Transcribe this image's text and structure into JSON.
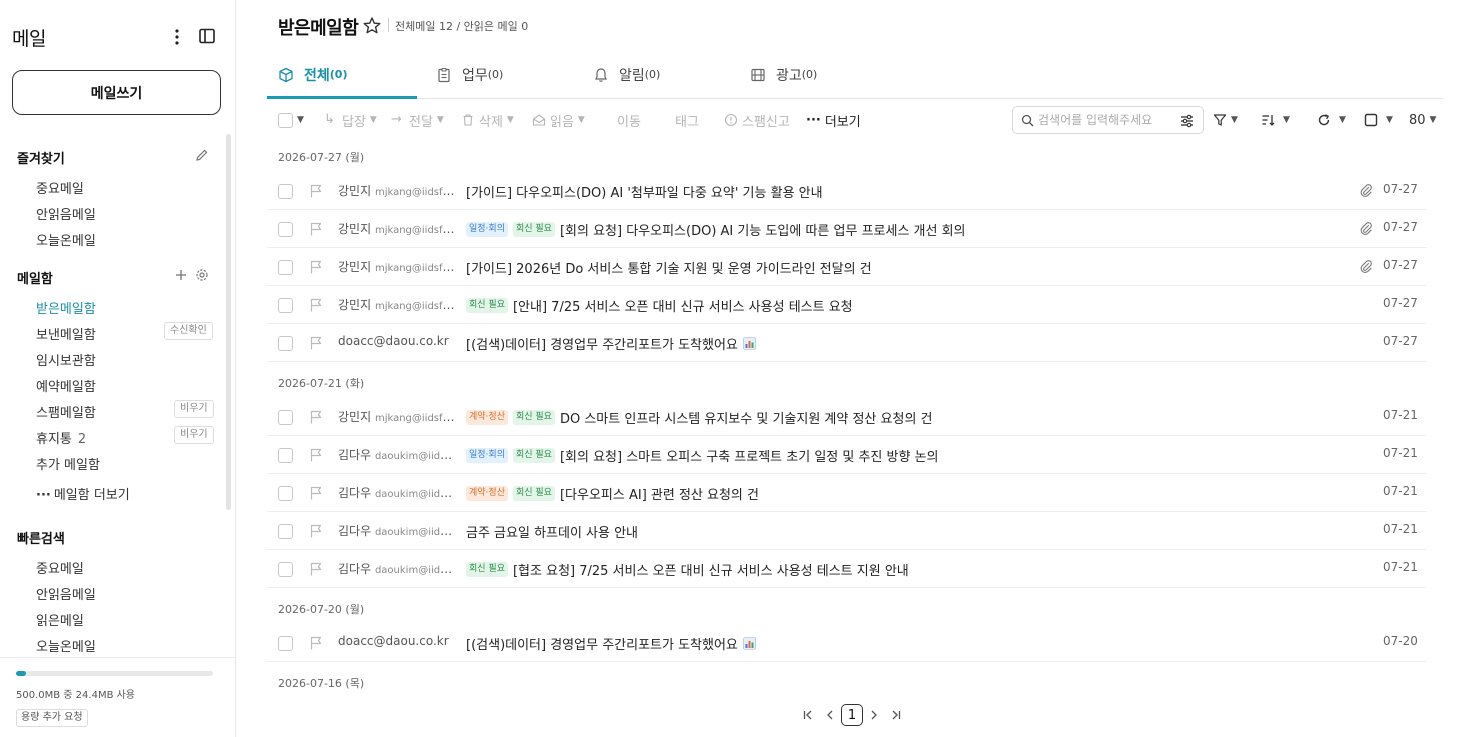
{
  "sidebar": {
    "title": "메일",
    "compose_label": "메일쓰기",
    "favorites": {
      "title": "즐겨찾기",
      "items": [
        "중요메일",
        "안읽음메일",
        "오늘온메일"
      ]
    },
    "mailboxes": {
      "title": "메일함",
      "inbox": "받은메일함",
      "sent": "보낸메일함",
      "sent_badge": "수신확인",
      "drafts": "임시보관함",
      "scheduled": "예약메일함",
      "spam": "스팸메일함",
      "spam_badge": "비우기",
      "trash": "휴지통",
      "trash_count": "2",
      "trash_badge": "비우기",
      "add": "추가 메일함",
      "more": "메일함 더보기"
    },
    "quick_search": {
      "title": "빠른검색",
      "items": [
        "중요메일",
        "안읽음메일",
        "읽은메일",
        "오늘온메일"
      ]
    },
    "quota": {
      "used_fraction": 0.049,
      "text": "500.0MB 중 24.4MB 사용",
      "add_label": "용량 추가 요청"
    }
  },
  "header": {
    "title": "받은메일함",
    "stats": "전체메일 12 / 안읽은 메일 0"
  },
  "tabs": [
    {
      "label": "전체",
      "count": "(0)",
      "icon": "cube-icon"
    },
    {
      "label": "업무",
      "count": "(0)",
      "icon": "clipboard-icon"
    },
    {
      "label": "알림",
      "count": "(0)",
      "icon": "bell-icon"
    },
    {
      "label": "광고",
      "count": "(0)",
      "icon": "film-icon"
    }
  ],
  "toolbar": {
    "reply": "답장",
    "forward": "전달",
    "delete": "삭제",
    "read": "읽음",
    "move": "이동",
    "tag": "태그",
    "spam": "스팸신고",
    "more": "더보기",
    "search_placeholder": "검색어를 입력해주세요",
    "page_size": "80"
  },
  "groups": [
    {
      "date": "2026-07-27 (월)",
      "mails": [
        {
          "name": "강민지",
          "email": "mjkang@iidsfn1...",
          "tags": [],
          "subject": "[가이드] 다우오피스(DO) AI '첨부파일 다중 요약' 기능 활용 안내",
          "attach": true,
          "chart": false,
          "date": "07-27"
        },
        {
          "name": "강민지",
          "email": "mjkang@iidsfn1...",
          "tags": [
            {
              "t": "일정·회의",
              "k": "meet"
            },
            {
              "t": "회신 필요",
              "k": "reply"
            }
          ],
          "subject": "[회의 요청] 다우오피스(DO) AI 기능 도입에 따른 업무 프로세스 개선 회의",
          "attach": true,
          "chart": false,
          "date": "07-27"
        },
        {
          "name": "강민지",
          "email": "mjkang@iidsfn1...",
          "tags": [],
          "subject": "[가이드] 2026년 Do 서비스 통합 기술 지원 및 운영 가이드라인 전달의 건",
          "attach": true,
          "chart": false,
          "date": "07-27"
        },
        {
          "name": "강민지",
          "email": "mjkang@iidsfn1...",
          "tags": [
            {
              "t": "회신 필요",
              "k": "reply"
            }
          ],
          "subject": "[안내] 7/25 서비스 오픈 대비 신규 서비스 사용성 테스트 요청",
          "attach": false,
          "chart": false,
          "date": "07-27"
        },
        {
          "name": "",
          "email": "doacc@daou.co.kr",
          "tags": [],
          "subject": "[(검색)데이터] 경영업무 주간리포트가 도착했어요",
          "attach": false,
          "chart": true,
          "date": "07-27"
        }
      ]
    },
    {
      "date": "2026-07-21 (화)",
      "mails": [
        {
          "name": "강민지",
          "email": "mjkang@iidsfn1...",
          "tags": [
            {
              "t": "계약·정산",
              "k": "bill"
            },
            {
              "t": "회신 필요",
              "k": "reply"
            }
          ],
          "subject": "DO 스마트 인프라 시스템 유지보수 및 기술지원 계약 정산 요청의 건",
          "attach": false,
          "chart": false,
          "date": "07-21"
        },
        {
          "name": "김다우",
          "email": "daoukim@iidsf...",
          "tags": [
            {
              "t": "일정·회의",
              "k": "meet"
            },
            {
              "t": "회신 필요",
              "k": "reply"
            }
          ],
          "subject": "[회의 요청] 스마트 오피스 구축 프로젝트 초기 일정 및 추진 방향 논의",
          "attach": false,
          "chart": false,
          "date": "07-21"
        },
        {
          "name": "김다우",
          "email": "daoukim@iidsf...",
          "tags": [
            {
              "t": "계약·정산",
              "k": "bill"
            },
            {
              "t": "회신 필요",
              "k": "reply"
            }
          ],
          "subject": "[다우오피스 AI] 관련 정산 요청의 건",
          "attach": false,
          "chart": false,
          "date": "07-21"
        },
        {
          "name": "김다우",
          "email": "daoukim@iidsf...",
          "tags": [],
          "subject": "금주 금요일 하프데이 사용 안내",
          "attach": false,
          "chart": false,
          "date": "07-21"
        },
        {
          "name": "김다우",
          "email": "daoukim@iidsf...",
          "tags": [
            {
              "t": "회신 필요",
              "k": "reply"
            }
          ],
          "subject": "[협조 요청] 7/25 서비스 오픈 대비 신규 서비스 사용성 테스트 지원 안내",
          "attach": false,
          "chart": false,
          "date": "07-21"
        }
      ]
    },
    {
      "date": "2026-07-20 (월)",
      "mails": [
        {
          "name": "",
          "email": "doacc@daou.co.kr",
          "tags": [],
          "subject": "[(검색)데이터] 경영업무 주간리포트가 도착했어요",
          "attach": false,
          "chart": true,
          "date": "07-20"
        }
      ]
    },
    {
      "date": "2026-07-16 (목)",
      "mails": []
    }
  ],
  "pager": {
    "current": "1"
  },
  "colors": {
    "accent": "#1a9bb0",
    "tag_meet": "#3a7fd0",
    "tag_reply": "#2e8b4e",
    "tag_bill": "#d4702e"
  }
}
